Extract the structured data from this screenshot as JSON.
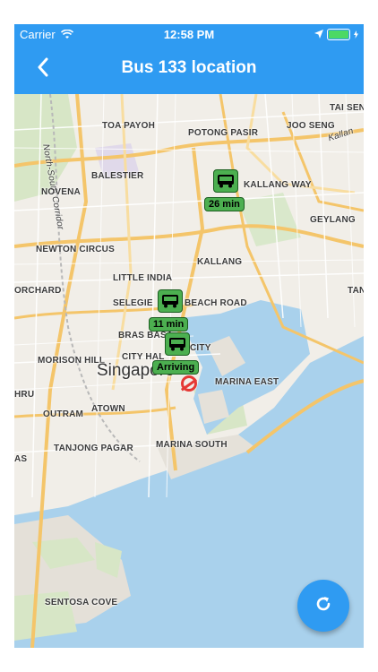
{
  "status": {
    "carrier": "Carrier",
    "time": "12:58 PM"
  },
  "header": {
    "title": "Bus 133 location"
  },
  "map_labels": {
    "toa_payoh": "TOA PAYOH",
    "potong_pasir": "POTONG PASIR",
    "joo_seng": "JOO SENG",
    "tai_sen": "TAI SEN",
    "balestier": "BALESTIER",
    "kallang_way": "KALLANG WAY",
    "novena": "NOVENA",
    "geylang": "GEYLANG",
    "newton_circus": "NEWTON CIRCUS",
    "kallang": "KALLANG",
    "orchard": "ORCHARD",
    "little_india": "LITTLE INDIA",
    "tan": "TAN",
    "selegie": "SELEGIE",
    "beach_road": "BEACH ROAD",
    "bras_basah": "BRAS BASA",
    "suntec_city": "CITY",
    "morison_hill": "MORISON HILL",
    "city_hall": "CITY HAL",
    "singapore": "Singapore",
    "marina_east": "MARINA EAST",
    "hru": "HRU",
    "outram": "OUTRAM",
    "atown": "ATOWN",
    "tanjong_pagar": "TANJONG PAGAR",
    "marina_south": "MARINA SOUTH",
    "as": "AS",
    "sentosa_cove": "SENTOSA COVE",
    "north_south_corridor": "North-South Corridor",
    "kallang_road": "Kallan"
  },
  "buses": [
    {
      "eta": "26 min"
    },
    {
      "eta": "11 min"
    },
    {
      "eta": "Arriving"
    }
  ],
  "colors": {
    "accent": "#2f9bf2",
    "bus_fill": "#4caf50",
    "stop": "#e53935"
  },
  "icons": {
    "back": "chevron-left-icon",
    "wifi": "wifi-icon",
    "location": "location-arrow-icon",
    "battery": "battery-icon",
    "refresh": "refresh-icon",
    "bus": "bus-icon"
  }
}
